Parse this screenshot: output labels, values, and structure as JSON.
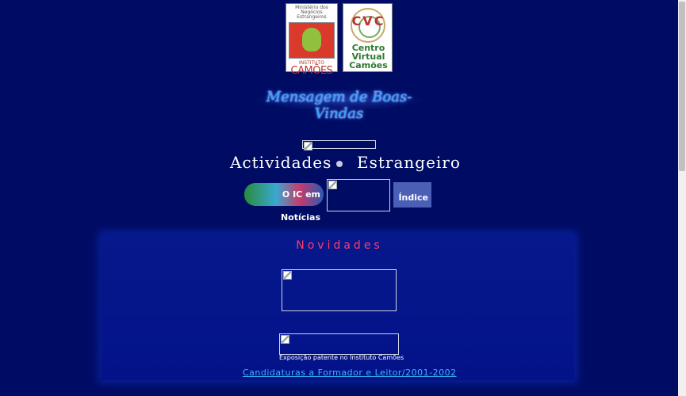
{
  "logos": {
    "instituto_camoes": {
      "ministry_line1": "Ministério dos Negócios",
      "ministry_line2": "Estrangeiros",
      "instituto": "INSTITUTO",
      "camoes": "CAMÕES"
    },
    "cvc": {
      "letters": "CVC",
      "line1": "Centro",
      "line2": "Virtual",
      "line3": "Camões"
    }
  },
  "welcome_title": "Mensagem de Boas-Vindas",
  "heading": {
    "word1": "Actividades",
    "word2": "Estrangeiro"
  },
  "nav": {
    "noticias_label": "O IC em Notícias",
    "indice_label": "Índice"
  },
  "novidades_title": "Novidades",
  "exposicao_caption": "Exposição patente no Instituto Camões",
  "candidaturas_link": "Candidaturas a Formador e Leitor/2001-2002",
  "colors": {
    "background": "#000c64",
    "accent": "#ff3c6a",
    "link": "#36b8f5"
  }
}
